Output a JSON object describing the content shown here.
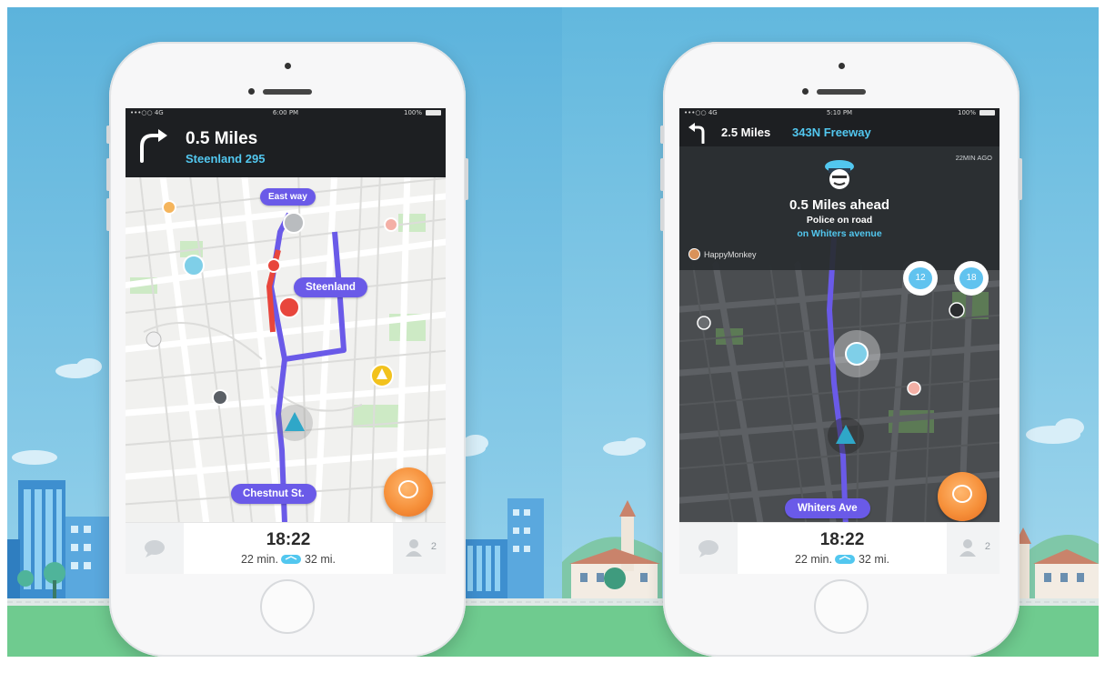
{
  "colors": {
    "sky": "#5eb6dd",
    "ground": "#6fcb8f",
    "route": "#6a5ae8",
    "accent_blue": "#52c7ef",
    "traffic": "#e8463c",
    "fab_orange": "#f6903a"
  },
  "phone_left": {
    "status": {
      "carrier": "•••○○ 4G",
      "time": "6:00 PM",
      "battery": "100%"
    },
    "nav": {
      "turn_icon": "turn-right-arrow-icon",
      "distance": "0.5 Miles",
      "street": "Steenland 295"
    },
    "map_labels": {
      "top": "East way",
      "mid": "Steenland",
      "bottom": "Chestnut St."
    },
    "bottom": {
      "eta": "18:22",
      "duration": "22 min.",
      "distance": "32 mi.",
      "users_count": "2"
    }
  },
  "phone_right": {
    "status": {
      "carrier": "•••○○ 4G",
      "time": "5:10 PM",
      "battery": "100%"
    },
    "nav": {
      "turn_icon": "turn-left-arrow-icon",
      "distance": "2.5 Miles",
      "street": "343N Freeway"
    },
    "alert": {
      "time_ago": "22MIN AGO",
      "title": "0.5 Miles ahead",
      "type": "Police on road",
      "location": "on Whiters avenue",
      "reporter": "HappyMonkey",
      "comments": "12",
      "thanks": "18"
    },
    "map_labels": {
      "bottom": "Whiters Ave"
    },
    "bottom": {
      "eta": "18:22",
      "duration": "22 min.",
      "distance": "32 mi.",
      "users_count": "2"
    }
  }
}
